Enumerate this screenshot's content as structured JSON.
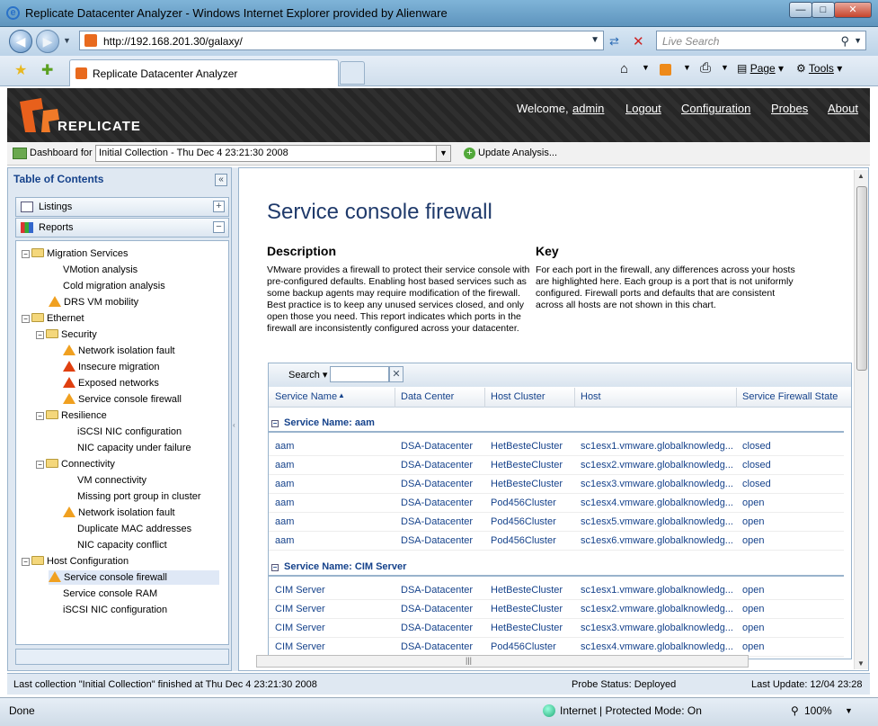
{
  "window": {
    "title": "Replicate Datacenter Analyzer - Windows Internet Explorer provided by Alienware"
  },
  "browser": {
    "address": "http://192.168.201.30/galaxy/",
    "search_placeholder": "Live Search",
    "tab_label": "Replicate Datacenter Analyzer",
    "page_menu": "Page",
    "tools_menu": "Tools"
  },
  "app": {
    "logo_text": "REPLICATE",
    "welcome": "Welcome,",
    "user": "admin",
    "logout": "Logout",
    "configuration": "Configuration",
    "probes": "Probes",
    "about": "About",
    "dashboard_label": "Dashboard for",
    "dashboard_value": "Initial Collection - Thu Dec  4 23:21:30 2008",
    "update_analysis": "Update Analysis..."
  },
  "sidebar": {
    "title": "Table of Contents",
    "listings": "Listings",
    "reports": "Reports",
    "tree": [
      {
        "label": "Migration Services",
        "type": "folder",
        "level": 0
      },
      {
        "label": "VMotion analysis",
        "type": "leaf",
        "level": 1
      },
      {
        "label": "Cold migration analysis",
        "type": "leaf",
        "level": 1
      },
      {
        "label": "DRS VM mobility",
        "type": "warn",
        "level": 1
      },
      {
        "label": "Ethernet",
        "type": "folder",
        "level": 0
      },
      {
        "label": "Security",
        "type": "folder",
        "level": 1
      },
      {
        "label": "Network isolation fault",
        "type": "warn",
        "level": 2
      },
      {
        "label": "Insecure migration",
        "type": "error",
        "level": 2
      },
      {
        "label": "Exposed networks",
        "type": "error",
        "level": 2
      },
      {
        "label": "Service console firewall",
        "type": "warn",
        "level": 2
      },
      {
        "label": "Resilience",
        "type": "folder",
        "level": 1
      },
      {
        "label": "iSCSI NIC configuration",
        "type": "leaf",
        "level": 2
      },
      {
        "label": "NIC capacity under failure",
        "type": "leaf",
        "level": 2
      },
      {
        "label": "Connectivity",
        "type": "folder",
        "level": 1
      },
      {
        "label": "VM connectivity",
        "type": "leaf",
        "level": 2
      },
      {
        "label": "Missing port group in cluster",
        "type": "leaf",
        "level": 2
      },
      {
        "label": "Network isolation fault",
        "type": "warn",
        "level": 2
      },
      {
        "label": "Duplicate MAC addresses",
        "type": "leaf",
        "level": 2
      },
      {
        "label": "NIC capacity conflict",
        "type": "leaf",
        "level": 2
      },
      {
        "label": "Host Configuration",
        "type": "folder",
        "level": 0
      },
      {
        "label": "Service console firewall",
        "type": "warn-selected",
        "level": 1
      },
      {
        "label": "Service console RAM",
        "type": "leaf",
        "level": 1
      },
      {
        "label": "iSCSI NIC configuration",
        "type": "leaf",
        "level": 1
      }
    ]
  },
  "main": {
    "title": "Service console firewall",
    "description_heading": "Description",
    "description": "VMware provides a firewall to protect their service console with pre-configured defaults. Enabling host based services such as some backup agents may require modification of the firewall. Best practice is to keep any unused services closed, and only open those you need. This report indicates which ports in the firewall are inconsistently configured across your datacenter.",
    "key_heading": "Key",
    "key": "For each port in the firewall, any differences across your hosts are highlighted here. Each group is a port that is not uniformly configured. Firewall ports and defaults that are consistent across all hosts are not shown in this chart.",
    "grid": {
      "search_label": "Search",
      "columns": [
        "Service Name",
        "Data Center",
        "Host Cluster",
        "Host",
        "Service Firewall State"
      ],
      "groups": [
        {
          "label": "Service Name: aam",
          "rows": [
            [
              "aam",
              "DSA-Datacenter",
              "HetBesteCluster",
              "sc1esx1.vmware.globalknowledg...",
              "closed"
            ],
            [
              "aam",
              "DSA-Datacenter",
              "HetBesteCluster",
              "sc1esx2.vmware.globalknowledg...",
              "closed"
            ],
            [
              "aam",
              "DSA-Datacenter",
              "HetBesteCluster",
              "sc1esx3.vmware.globalknowledg...",
              "closed"
            ],
            [
              "aam",
              "DSA-Datacenter",
              "Pod456Cluster",
              "sc1esx4.vmware.globalknowledg...",
              "open"
            ],
            [
              "aam",
              "DSA-Datacenter",
              "Pod456Cluster",
              "sc1esx5.vmware.globalknowledg...",
              "open"
            ],
            [
              "aam",
              "DSA-Datacenter",
              "Pod456Cluster",
              "sc1esx6.vmware.globalknowledg...",
              "open"
            ]
          ]
        },
        {
          "label": "Service Name: CIM Server",
          "rows": [
            [
              "CIM Server",
              "DSA-Datacenter",
              "HetBesteCluster",
              "sc1esx1.vmware.globalknowledg...",
              "open"
            ],
            [
              "CIM Server",
              "DSA-Datacenter",
              "HetBesteCluster",
              "sc1esx2.vmware.globalknowledg...",
              "open"
            ],
            [
              "CIM Server",
              "DSA-Datacenter",
              "HetBesteCluster",
              "sc1esx3.vmware.globalknowledg...",
              "open"
            ],
            [
              "CIM Server",
              "DSA-Datacenter",
              "Pod456Cluster",
              "sc1esx4.vmware.globalknowledg...",
              "open"
            ]
          ]
        }
      ]
    }
  },
  "status": {
    "last_collection": "Last collection \"Initial Collection\" finished at Thu Dec 4 23:21:30 2008",
    "probe_status": "Probe Status: Deployed",
    "last_update": "Last Update: 12/04 23:28"
  },
  "ie_status": {
    "done": "Done",
    "zone": "Internet | Protected Mode: On",
    "zoom": "100%"
  }
}
